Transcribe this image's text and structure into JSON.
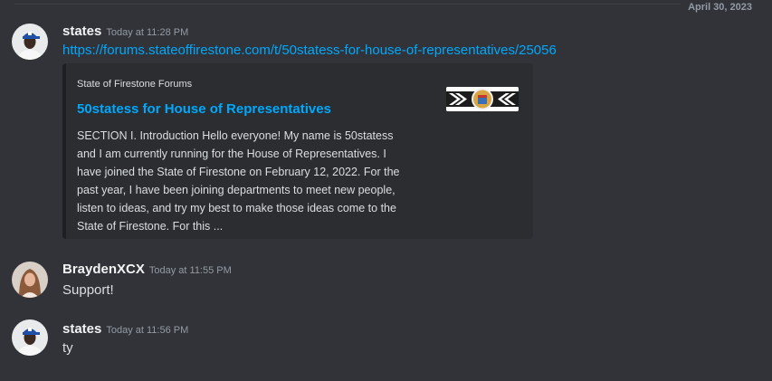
{
  "divider": {
    "date": "April 30, 2023"
  },
  "messages": [
    {
      "username": "states",
      "timestamp": "Today at 11:28 PM",
      "link": "https://forums.stateoffirestone.com/t/50statess-for-house-of-representatives/25056",
      "embed": {
        "provider": "State of Firestone Forums",
        "title": "50statess for House of Representatives",
        "description_lines": [
          "SECTION I. Introduction Hello everyone! My name is 50statess",
          "and I am currently running for the House of Representatives. I",
          "have joined the State of Firestone on February 12, 2022. For the",
          "past year, I have been joining departments to meet new people,",
          "listen to ideas, and try my best to make those ideas come to the",
          "State of Firestone. For this ..."
        ]
      }
    },
    {
      "username": "BraydenXCX",
      "timestamp": "Today at 11:55 PM",
      "text": "Support!"
    },
    {
      "username": "states",
      "timestamp": "Today at 11:56 PM",
      "text": "ty"
    }
  ],
  "colors": {
    "background": "#313338",
    "link": "#00a8fc",
    "embed_background": "#2b2d31",
    "username": "#f2f3f5",
    "timestamp": "#949ba4"
  }
}
